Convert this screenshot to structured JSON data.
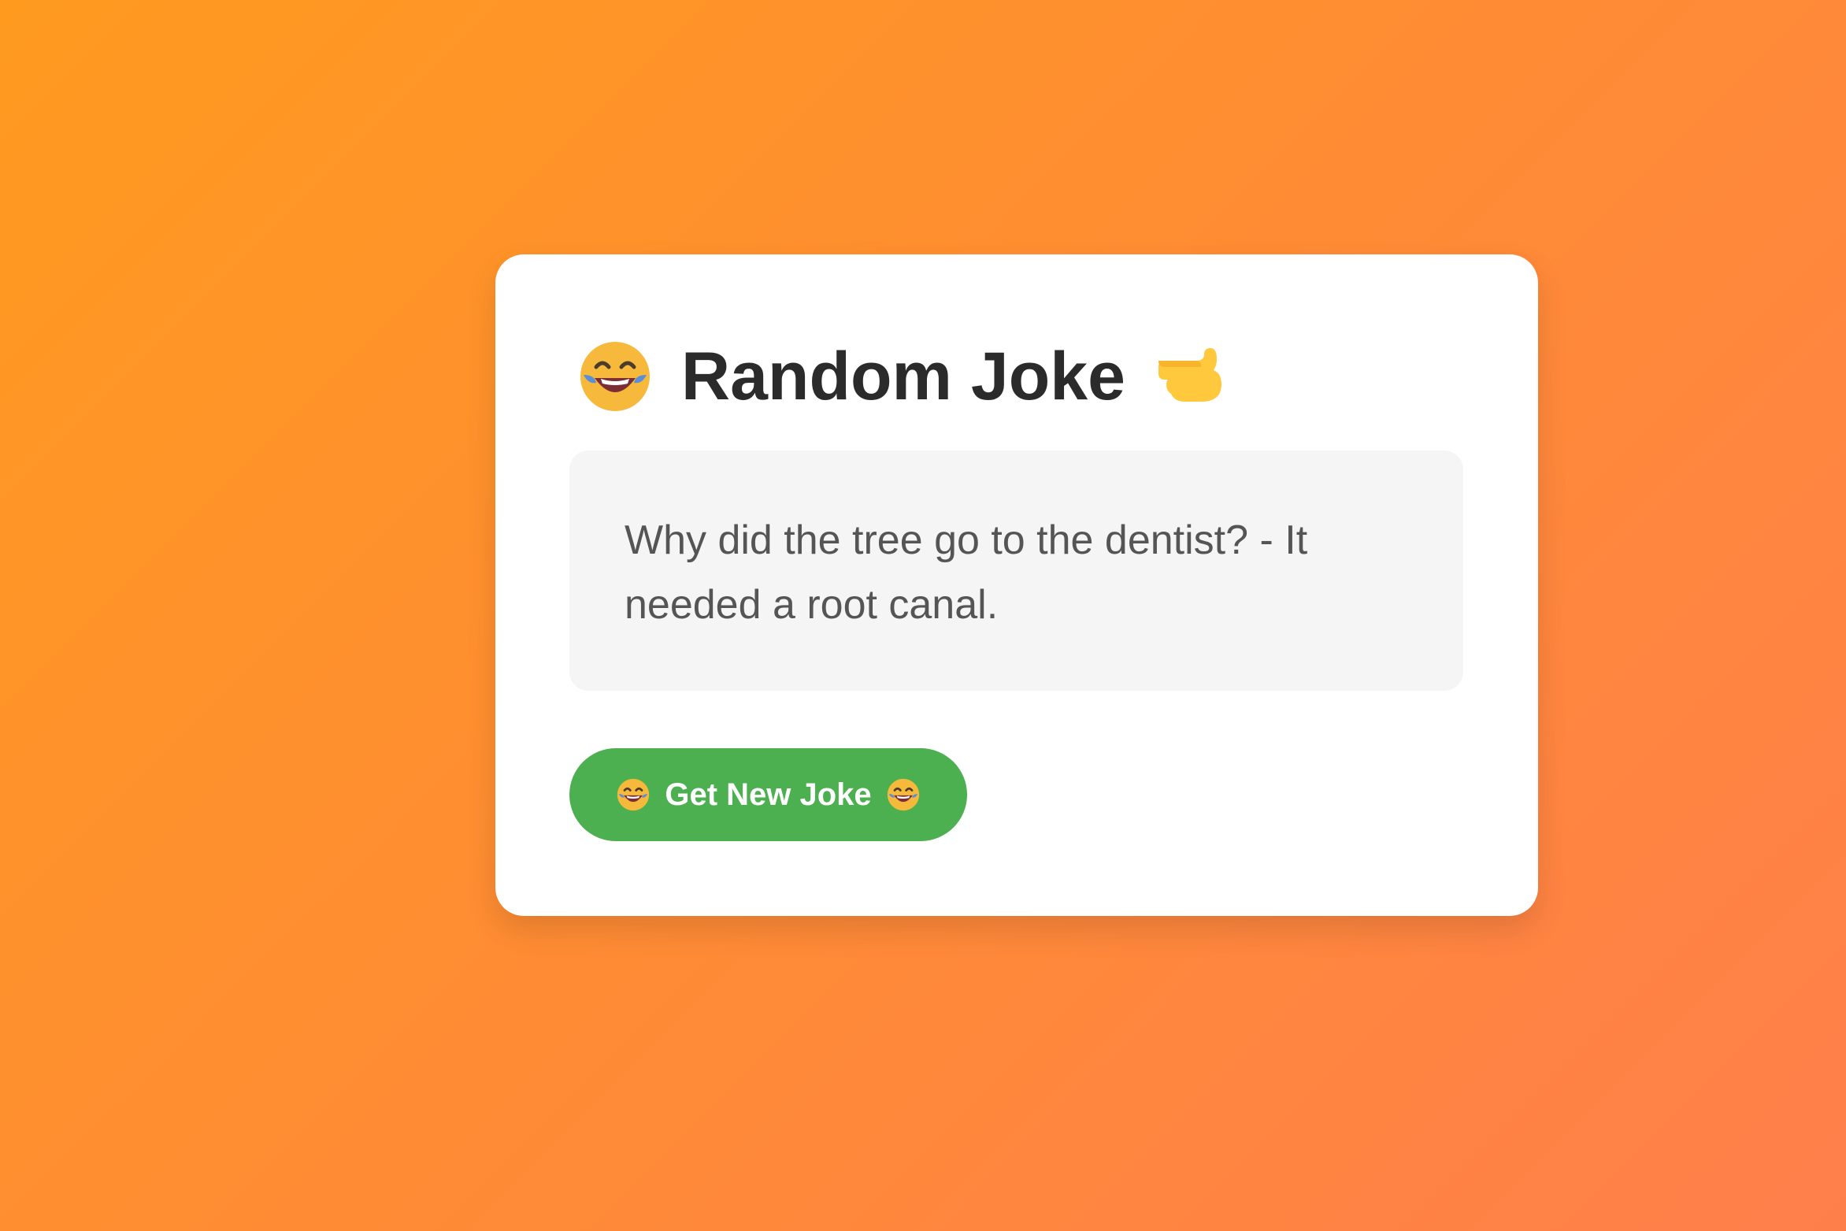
{
  "card": {
    "title": "Random Joke",
    "title_left_icon": "face-with-tears-of-joy-icon",
    "title_right_icon": "pointing-hand-icon",
    "joke": "Why did the tree go to the dentist? - It needed a root canal."
  },
  "button": {
    "label": "Get New Joke",
    "icon": "face-with-tears-of-joy-icon"
  },
  "colors": {
    "background_start": "#ff9a1f",
    "background_end": "#ff7f4b",
    "card": "#ffffff",
    "joke_box": "#f5f5f5",
    "button": "#4caf50",
    "title_text": "#2b2b2b",
    "joke_text": "#555555"
  }
}
